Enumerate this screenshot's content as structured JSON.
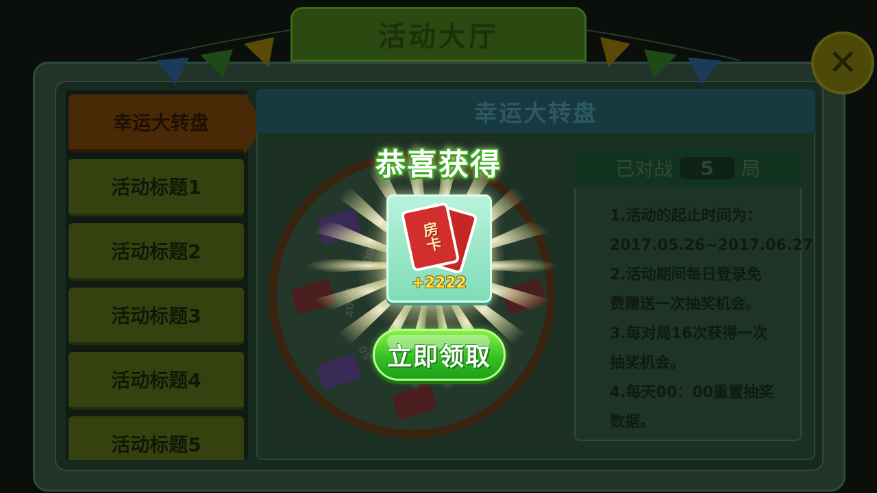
{
  "window": {
    "title": "活动大厅",
    "close_icon": "close-x-icon"
  },
  "menu": {
    "items": [
      {
        "label": "幸运大转盘",
        "active": true
      },
      {
        "label": "活动标题1",
        "active": false
      },
      {
        "label": "活动标题2",
        "active": false
      },
      {
        "label": "活动标题3",
        "active": false
      },
      {
        "label": "活动标题4",
        "active": false
      },
      {
        "label": "活动标题5",
        "active": false
      }
    ]
  },
  "panel": {
    "title": "幸运大转盘",
    "games_prefix": "已对战",
    "games_count": "5",
    "games_suffix": "局",
    "rules": [
      "1.活动的起止时间为：",
      "2017.05.26~2017.06.27",
      "2.活动期间每日登录免",
      "费赠送一次抽奖机会。",
      "3.每对局16次获得一次",
      "抽奖机会。",
      "4.每天00：00重置抽奖",
      "数据。"
    ],
    "wheel_labels": [
      "6000",
      "4000",
      "50"
    ]
  },
  "popup": {
    "title": "恭喜获得",
    "item_name": "房卡",
    "amount": "+2222",
    "claim_label": "立即领取"
  },
  "colors": {
    "claim_green": "#36c024",
    "popup_title_outline": "#3aa81e",
    "card_red": "#d22e2e",
    "amount_gold": "#ffe34d"
  }
}
